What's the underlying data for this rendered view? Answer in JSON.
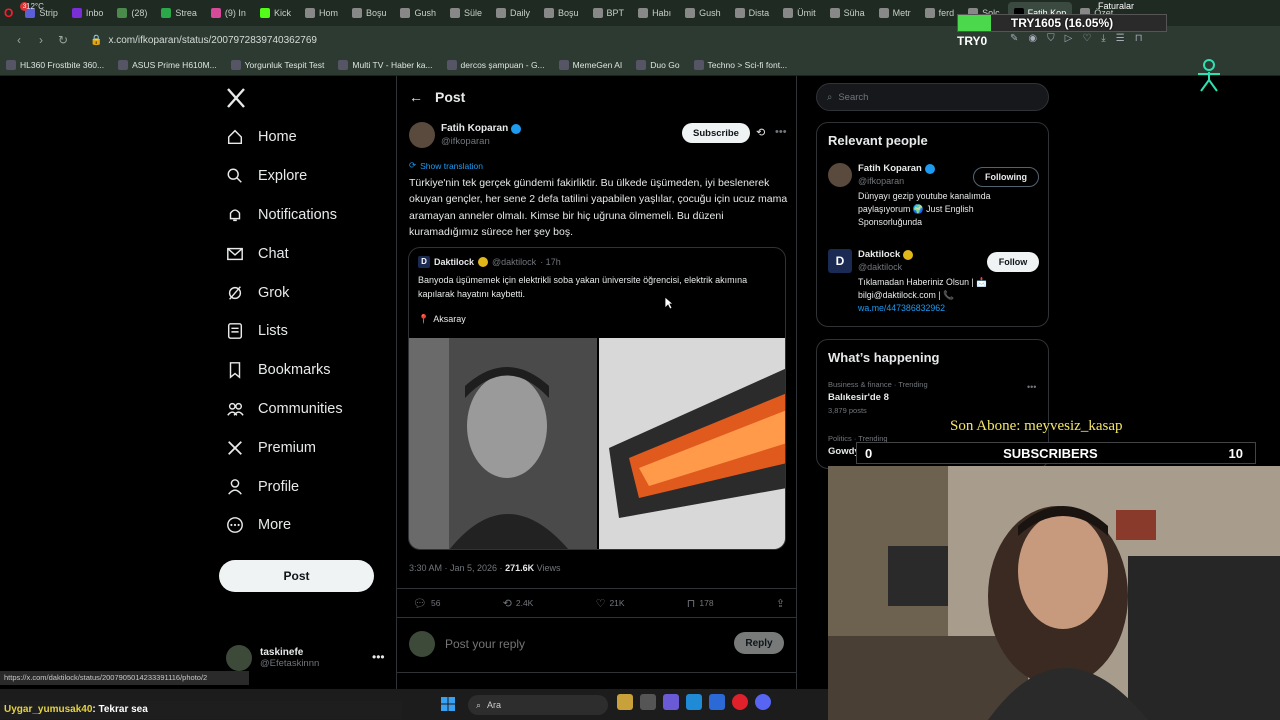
{
  "browser": {
    "tabs": [
      {
        "label": "Strip",
        "color": "#5a5fd6"
      },
      {
        "label": "Inbo",
        "color": "#7a2fd6"
      },
      {
        "label": "(28)",
        "color": "#4a8a4a"
      },
      {
        "label": "Strea",
        "color": "#2aa84a"
      },
      {
        "label": "(9) In",
        "color": "#d64a9a"
      },
      {
        "label": "Kick",
        "color": "#53fc18"
      },
      {
        "label": "Hom",
        "color": "#888888"
      },
      {
        "label": "Boşu",
        "color": "#888888"
      },
      {
        "label": "Gush",
        "color": "#888888"
      },
      {
        "label": "Süle",
        "color": "#888888"
      },
      {
        "label": "Daily",
        "color": "#888888"
      },
      {
        "label": "Boşu",
        "color": "#888888"
      },
      {
        "label": "BPT",
        "color": "#888888"
      },
      {
        "label": "Habı",
        "color": "#888888"
      },
      {
        "label": "Gush",
        "color": "#888888"
      },
      {
        "label": "Dista",
        "color": "#888888"
      },
      {
        "label": "Ümit",
        "color": "#888888"
      },
      {
        "label": "Süha",
        "color": "#888888"
      },
      {
        "label": "Metr",
        "color": "#888888"
      },
      {
        "label": "ferd",
        "color": "#888888"
      },
      {
        "label": "Solc",
        "color": "#888888"
      },
      {
        "label": "Fatih Kop",
        "color": "#000000",
        "active": true
      },
      {
        "label": "Özet",
        "color": "#888888"
      }
    ],
    "url": "x.com/ifkoparan/status/2007972839740362769",
    "bookmarks": [
      "HL360 Frostbite 360...",
      "ASUS Prime H610M...",
      "Yorgunluk Tespit Test",
      "Multi TV - Haber ka...",
      "dercos şampuan - G...",
      "MemeGen AI",
      "Duo Go",
      "Techno > Sci-fi font..."
    ],
    "status_url": "https://x.com/daktilock/status/2007905014233391116/photo/2"
  },
  "overlay": {
    "goal_text": "TRY1605 (16.05%)",
    "goal_percent": 16.05,
    "goal_label": "Faturalar",
    "balance": "TRY0",
    "last_sub_label": "Son Abone: meyvesiz_kasap",
    "subs_left": "0",
    "subs_title": "SUBSCRIBERS",
    "subs_right": "10"
  },
  "sidebar": {
    "items": [
      {
        "label": "Home",
        "icon": "home-icon"
      },
      {
        "label": "Explore",
        "icon": "search-icon"
      },
      {
        "label": "Notifications",
        "icon": "bell-icon"
      },
      {
        "label": "Chat",
        "icon": "mail-icon"
      },
      {
        "label": "Grok",
        "icon": "grok-icon"
      },
      {
        "label": "Lists",
        "icon": "list-icon"
      },
      {
        "label": "Bookmarks",
        "icon": "bookmark-icon"
      },
      {
        "label": "Communities",
        "icon": "people-icon"
      },
      {
        "label": "Premium",
        "icon": "x-icon"
      },
      {
        "label": "Profile",
        "icon": "person-icon"
      },
      {
        "label": "More",
        "icon": "more-icon"
      }
    ],
    "post_label": "Post",
    "account": {
      "name": "taskinefe",
      "handle": "@Efetaskinnn"
    }
  },
  "post": {
    "header_title": "Post",
    "author_name": "Fatih Koparan",
    "author_handle": "@ifkoparan",
    "subscribe_label": "Subscribe",
    "show_translation": "Show translation",
    "text": "Türkiye'nin tek gerçek gündemi fakirliktir. Bu ülkede üşümeden, iyi beslenerek okuyan gençler, her sene 2 defa tatilini yapabilen yaşlılar, çocuğu için ucuz mama aramayan anneler olmalı. Kimse bir hiç uğruna ölmemeli. Bu düzeni kuramadığımız sürece her şey boş.",
    "quote": {
      "name": "Daktilock",
      "handle": "@daktilock",
      "time": "· 17h",
      "text": "Banyoda üşümemek için elektrikli soba yakan üniversite öğrencisi, elektrik akımına kapılarak hayatını kaybetti.",
      "location": "Aksaray"
    },
    "timestamp": "3:30 AM · Jan 5, 2026 · ",
    "views_count": "271.6K",
    "views_label": "Views",
    "replies": "56",
    "reposts": "2.4K",
    "likes": "21K",
    "bookmarks": "178",
    "reply_placeholder": "Post your reply",
    "reply_label": "Reply"
  },
  "right": {
    "search_placeholder": "Search",
    "relevant_title": "Relevant people",
    "people": [
      {
        "name": "Fatih Koparan",
        "handle": "@ifkoparan",
        "bio": "Dünyayı gezip youtube kanalımda paylaşıyorum 🌍 Just English Sponsorluğunda",
        "button": "Following"
      },
      {
        "name": "Daktilock",
        "handle": "@daktilock",
        "bio": "Tıklamadan Haberiniz Olsun | 📩 bilgi@daktilock.com | 📞",
        "link": "wa.me/447386832962",
        "button": "Follow"
      }
    ],
    "happening_title": "What’s happening",
    "trends": [
      {
        "category": "Business & finance · Trending",
        "title": "Balıkesir'de 8",
        "count": "3,879 posts"
      },
      {
        "category": "Politics · Trending",
        "title": "Gowdy"
      }
    ]
  },
  "chat": {
    "user": "Uygar_yumusak40",
    "message": ": Tekrar sea"
  },
  "taskbar": {
    "weather": "12°C",
    "badge": "3",
    "search_label": "Ara"
  }
}
